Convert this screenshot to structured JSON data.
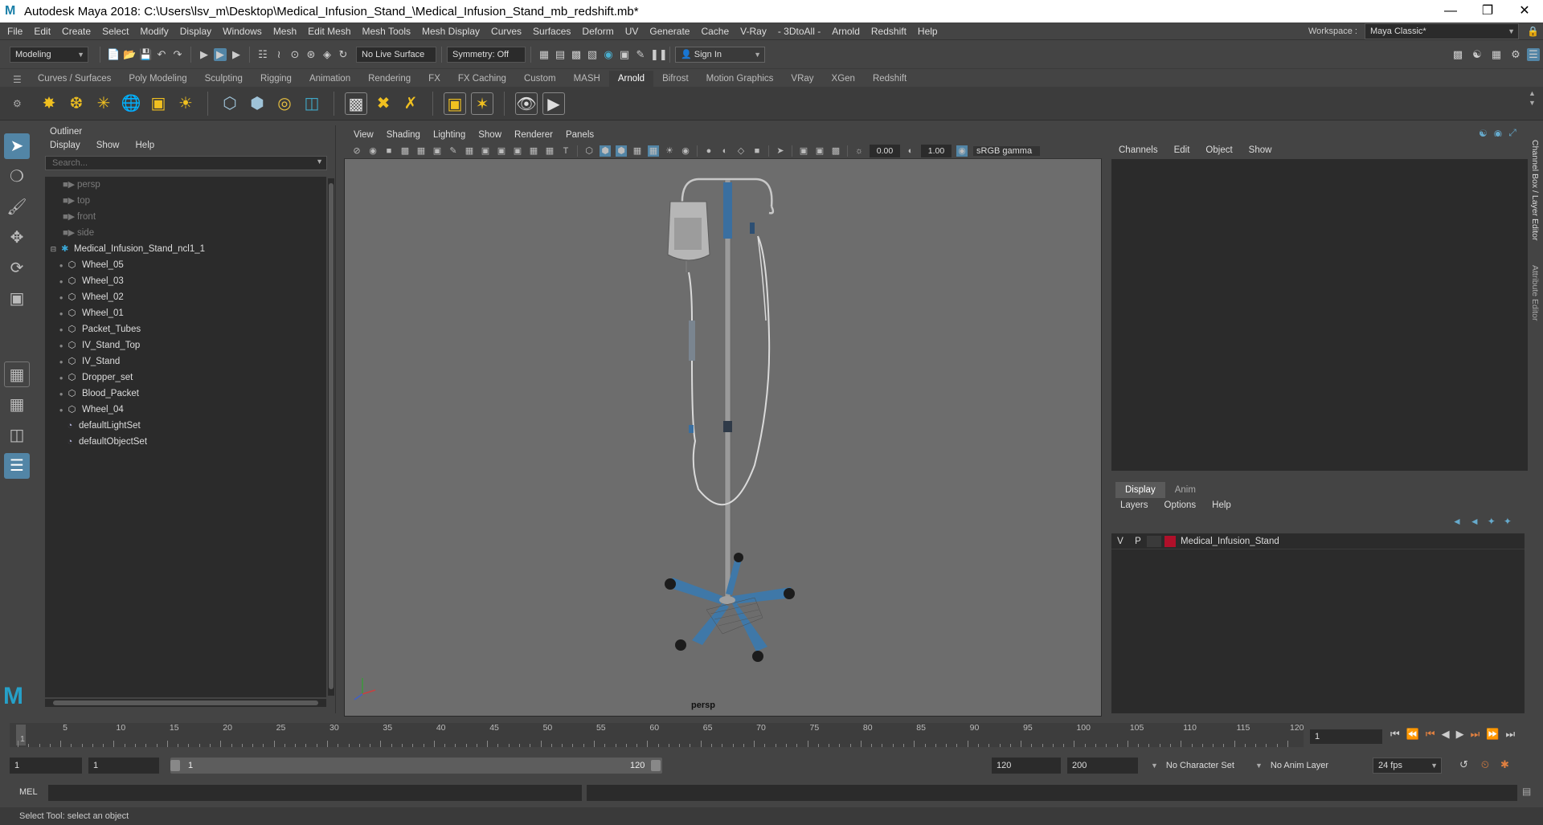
{
  "window": {
    "title": "Autodesk Maya 2018: C:\\Users\\lsv_m\\Desktop\\Medical_Infusion_Stand_\\Medical_Infusion_Stand_mb_redshift.mb*"
  },
  "menubar": {
    "items": [
      "File",
      "Edit",
      "Create",
      "Select",
      "Modify",
      "Display",
      "Windows",
      "Mesh",
      "Edit Mesh",
      "Mesh Tools",
      "Mesh Display",
      "Curves",
      "Surfaces",
      "Deform",
      "UV",
      "Generate",
      "Cache",
      "V-Ray",
      "- 3DtoAll -",
      "Arnold",
      "Redshift",
      "Help"
    ],
    "workspace_label": "Workspace :",
    "workspace_value": "Maya Classic*"
  },
  "statusline": {
    "mode": "Modeling",
    "live_surface": "No Live Surface",
    "symmetry": "Symmetry: Off",
    "sign_in": "Sign In"
  },
  "shelf": {
    "tabs": [
      "Curves / Surfaces",
      "Poly Modeling",
      "Sculpting",
      "Rigging",
      "Animation",
      "Rendering",
      "FX",
      "FX Caching",
      "Custom",
      "MASH",
      "Arnold",
      "Bifrost",
      "Motion Graphics",
      "VRay",
      "XGen",
      "Redshift"
    ],
    "active": "Arnold"
  },
  "outliner": {
    "title": "Outliner",
    "menu": [
      "Display",
      "Show",
      "Help"
    ],
    "search_placeholder": "Search...",
    "cameras": [
      "persp",
      "top",
      "front",
      "side"
    ],
    "group": "Medical_Infusion_Stand_ncl1_1",
    "children": [
      "Wheel_05",
      "Wheel_03",
      "Wheel_02",
      "Wheel_01",
      "Packet_Tubes",
      "IV_Stand_Top",
      "IV_Stand",
      "Dropper_set",
      "Blood_Packet",
      "Wheel_04"
    ],
    "sets": [
      "defaultLightSet",
      "defaultObjectSet"
    ]
  },
  "viewport": {
    "menu": [
      "View",
      "Shading",
      "Lighting",
      "Show",
      "Renderer",
      "Panels"
    ],
    "exposure": "0.00",
    "gamma": "1.00",
    "colorspace": "sRGB gamma",
    "camera": "persp"
  },
  "channelbox": {
    "menu": [
      "Channels",
      "Edit",
      "Object",
      "Show"
    ],
    "side_tabs": [
      "Channel Box / Layer Editor",
      "Attribute Editor"
    ]
  },
  "layereditor": {
    "tabs": [
      "Display",
      "Anim"
    ],
    "active_tab": "Display",
    "menu": [
      "Layers",
      "Options",
      "Help"
    ],
    "layer": {
      "v": "V",
      "p": "P",
      "name": "Medical_Infusion_Stand",
      "color": "#b0102a"
    }
  },
  "timeline": {
    "ticks": [
      "1",
      "5",
      "10",
      "15",
      "20",
      "25",
      "30",
      "35",
      "40",
      "45",
      "50",
      "55",
      "60",
      "65",
      "70",
      "75",
      "80",
      "85",
      "90",
      "95",
      "100",
      "105",
      "110",
      "115",
      "120"
    ],
    "current_frame": "1"
  },
  "range": {
    "start": "1",
    "anim_start": "1",
    "range_start": "1",
    "range_end": "120",
    "end": "120",
    "anim_end": "200",
    "character_set": "No Character Set",
    "anim_layer": "No Anim Layer",
    "fps": "24 fps"
  },
  "commandline": {
    "label": "MEL"
  },
  "helpline": {
    "text": "Select Tool: select an object"
  }
}
